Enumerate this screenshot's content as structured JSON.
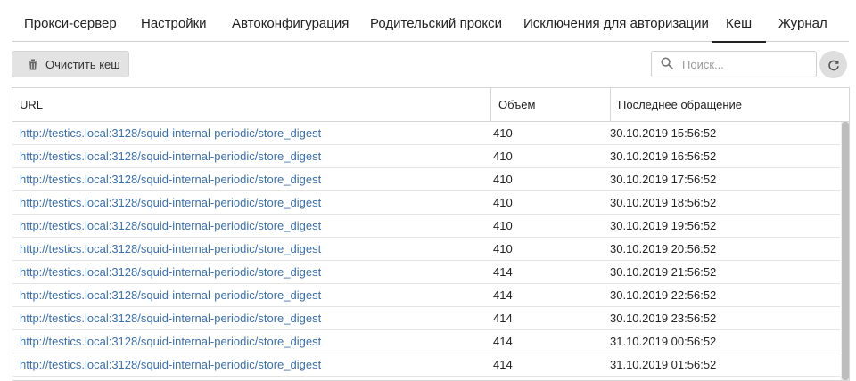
{
  "tabs": [
    {
      "label": "Прокси-сервер",
      "active": false
    },
    {
      "label": "Настройки",
      "active": false
    },
    {
      "label": "Автоконфигурация",
      "active": false
    },
    {
      "label": "Родительский прокси",
      "active": false
    },
    {
      "label": "Исключения для авторизации",
      "active": false
    },
    {
      "label": "Кеш",
      "active": true
    },
    {
      "label": "Журнал",
      "active": false
    }
  ],
  "toolbar": {
    "clear_label": "Очистить кеш",
    "clear_icon": "trash-icon",
    "search_placeholder": "Поиск...",
    "search_value": "",
    "search_icon": "search-icon",
    "refresh_icon": "refresh-icon"
  },
  "table": {
    "columns": [
      "URL",
      "Объем",
      "Последнее обращение"
    ],
    "rows": [
      {
        "url": "http://testics.local:3128/squid-internal-periodic/store_digest",
        "size": "410",
        "last_access": "30.10.2019 15:56:52"
      },
      {
        "url": "http://testics.local:3128/squid-internal-periodic/store_digest",
        "size": "410",
        "last_access": "30.10.2019 16:56:52"
      },
      {
        "url": "http://testics.local:3128/squid-internal-periodic/store_digest",
        "size": "410",
        "last_access": "30.10.2019 17:56:52"
      },
      {
        "url": "http://testics.local:3128/squid-internal-periodic/store_digest",
        "size": "410",
        "last_access": "30.10.2019 18:56:52"
      },
      {
        "url": "http://testics.local:3128/squid-internal-periodic/store_digest",
        "size": "410",
        "last_access": "30.10.2019 19:56:52"
      },
      {
        "url": "http://testics.local:3128/squid-internal-periodic/store_digest",
        "size": "410",
        "last_access": "30.10.2019 20:56:52"
      },
      {
        "url": "http://testics.local:3128/squid-internal-periodic/store_digest",
        "size": "414",
        "last_access": "30.10.2019 21:56:52"
      },
      {
        "url": "http://testics.local:3128/squid-internal-periodic/store_digest",
        "size": "414",
        "last_access": "30.10.2019 22:56:52"
      },
      {
        "url": "http://testics.local:3128/squid-internal-periodic/store_digest",
        "size": "414",
        "last_access": "30.10.2019 23:56:52"
      },
      {
        "url": "http://testics.local:3128/squid-internal-periodic/store_digest",
        "size": "414",
        "last_access": "31.10.2019 00:56:52"
      },
      {
        "url": "http://testics.local:3128/squid-internal-periodic/store_digest",
        "size": "414",
        "last_access": "31.10.2019 01:56:52"
      }
    ]
  },
  "colors": {
    "link": "#3a6fae",
    "button_bg": "#e3e3e3",
    "border": "#d6d6d6",
    "active_tab_underline": "#222222"
  }
}
